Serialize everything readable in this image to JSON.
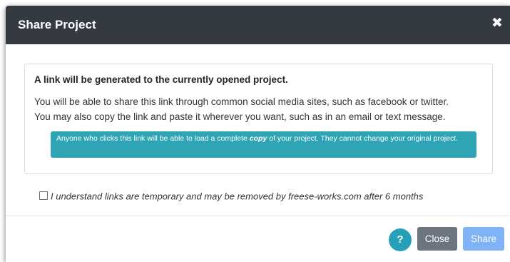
{
  "modal": {
    "title": "Share Project",
    "close_icon_glyph": "✖"
  },
  "card": {
    "heading": "A link will be generated to the currently opened project.",
    "text_line1": "You will be able to share this link through common social media sites, such as facebook or twitter.",
    "text_line2": "You may also copy the link and paste it wherever you want, such as in an email or text message.",
    "info_prefix": "Anyone who clicks this link will be able to load a complete ",
    "info_emphasis": "copy",
    "info_suffix": " of your project. They cannot change your original project."
  },
  "agreement": {
    "label": "I understand links are temporary and may be removed by freese-works.com after 6 months",
    "checked": false
  },
  "footer": {
    "help_label": "?",
    "close_label": "Close",
    "share_label": "Share"
  },
  "colors": {
    "header_bg": "#343a40",
    "info_bg": "#2fa4b5",
    "help_bg": "#26a0b8",
    "close_bg": "#6c757d",
    "share_bg": "#7fb2f7"
  },
  "icons": {
    "close": "close-icon",
    "help": "help-icon",
    "checkbox": "checkbox-icon"
  }
}
